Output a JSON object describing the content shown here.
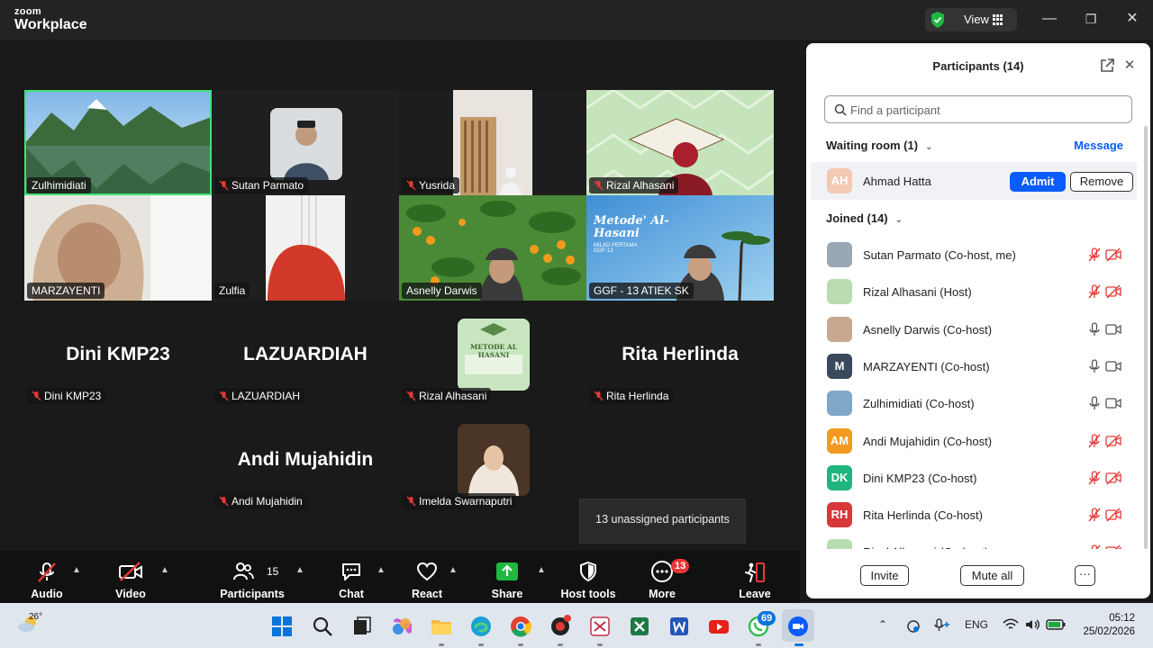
{
  "window": {
    "logo_line1": "zoom",
    "logo_line2": "Workplace",
    "view_label": "View"
  },
  "tiles": [
    {
      "name": "Zulhimidiati",
      "muted": false
    },
    {
      "name": "Sutan Parmato",
      "muted": true
    },
    {
      "name": "Yusrida",
      "muted": true
    },
    {
      "name": "Rizal Alhasani",
      "muted": true
    },
    {
      "name": "MARZAYENTI",
      "muted": false
    },
    {
      "name": "Zulfia",
      "muted": false
    },
    {
      "name": "Asnelly Darwis",
      "muted": false
    },
    {
      "name": "GGF - 13 ATIEK SK",
      "muted": false
    }
  ],
  "video_off": [
    {
      "big": "Dini KMP23",
      "tag": "Dini KMP23"
    },
    {
      "big": "LAZUARDIAH",
      "tag": "LAZUARDIAH"
    },
    {
      "big": "",
      "tag": "Rizal Alhasani"
    },
    {
      "big": "Rita Herlinda",
      "tag": "Rita Herlinda"
    },
    {
      "big": "Andi Mujahidin",
      "tag": "Andi Mujahidin"
    },
    {
      "big": "",
      "tag": "Imelda Swarnaputri"
    }
  ],
  "tile_text": {
    "metode_title": "Metode' Al-Hasani",
    "metode_sub": "MILAD PERTAMA GGF-13",
    "logo_small": "METODE AL HASANI"
  },
  "tooltip": "13 unassigned participants",
  "toolbar": {
    "audio": "Audio",
    "video": "Video",
    "participants": "Participants",
    "participants_count": "15",
    "chat": "Chat",
    "react": "React",
    "share": "Share",
    "host_tools": "Host tools",
    "more": "More",
    "more_badge": "13",
    "leave": "Leave"
  },
  "panel": {
    "title": "Participants (14)",
    "search_placeholder": "Find a participant",
    "waiting_label": "Waiting room (1)",
    "message_label": "Message",
    "waiting": {
      "initials": "AH",
      "name": "Ahmad Hatta",
      "avatar_color": "#f3c9b4"
    },
    "admit_label": "Admit",
    "remove_label": "Remove",
    "joined_label": "Joined (14)",
    "participants": [
      {
        "name": "Sutan Parmato (Co-host, me)",
        "initials": "",
        "color": "#9aa7b4",
        "muted": true
      },
      {
        "name": "Rizal Alhasani (Host)",
        "initials": "",
        "color": "#b9dcb0",
        "muted": true
      },
      {
        "name": "Asnelly Darwis (Co-host)",
        "initials": "",
        "color": "#c8a890",
        "muted": false
      },
      {
        "name": "MARZAYENTI (Co-host)",
        "initials": "M",
        "color": "#3a4a5c",
        "muted": false
      },
      {
        "name": "Zulhimidiati (Co-host)",
        "initials": "",
        "color": "#7fa7c8",
        "muted": false
      },
      {
        "name": "Andi Mujahidin (Co-host)",
        "initials": "AM",
        "color": "#f29a1f",
        "muted": true
      },
      {
        "name": "Dini KMP23 (Co-host)",
        "initials": "DK",
        "color": "#1fb57e",
        "muted": true
      },
      {
        "name": "Rita Herlinda (Co-host)",
        "initials": "RH",
        "color": "#d8383a",
        "muted": true
      },
      {
        "name": "Rizal Alhasani (Co-host)",
        "initials": "",
        "color": "#b9dcb0",
        "muted": true
      }
    ],
    "invite_label": "Invite",
    "mute_all_label": "Mute all",
    "more_label": "···"
  },
  "taskbar": {
    "temperature": "26°",
    "lang": "ENG",
    "whatsapp_badge": "69",
    "time": "05:12",
    "date": "25/02/2026"
  },
  "colors": {
    "accent": "#0b5cff",
    "active_speaker": "#3fe27a",
    "mute_red": "#e53935"
  }
}
